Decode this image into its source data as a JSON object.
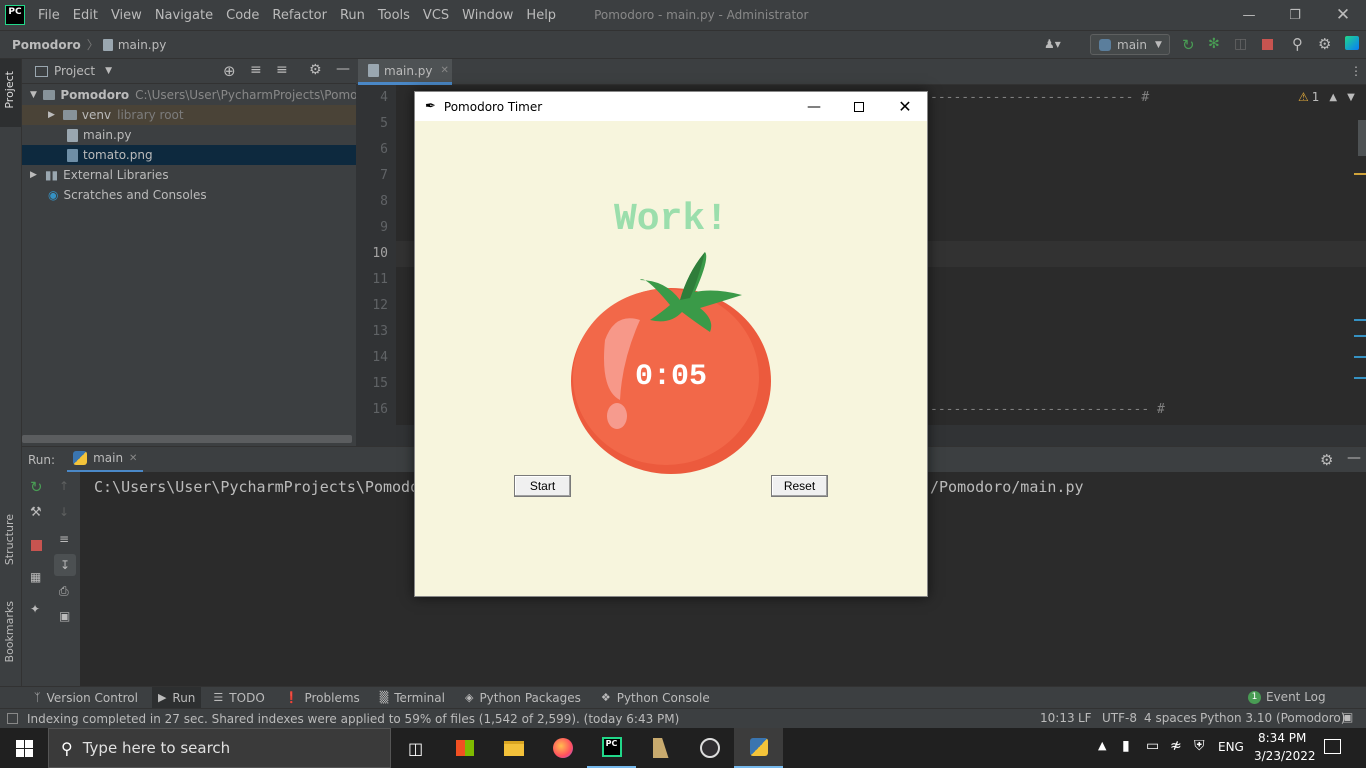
{
  "menubar": {
    "logo": "PC",
    "items": [
      "File",
      "Edit",
      "View",
      "Navigate",
      "Code",
      "Refactor",
      "Run",
      "Tools",
      "VCS",
      "Window",
      "Help"
    ],
    "window_title": "Pomodoro - main.py - Administrator"
  },
  "navbar": {
    "project": "Pomodoro",
    "file": "main.py",
    "run_config": "main"
  },
  "left_tools": {
    "project": "Project",
    "structure": "Structure",
    "bookmarks": "Bookmarks"
  },
  "project_panel": {
    "title": "Project",
    "root_name": "Pomodoro",
    "root_path": "C:\\Users\\User\\PycharmProjects\\Pomodoro",
    "venv": "venv",
    "venv_note": "library root",
    "file1": "main.py",
    "file2": "tomato.png",
    "external": "External Libraries",
    "scratches": "Scratches and Consoles"
  },
  "editor": {
    "tab": "main.py",
    "line_numbers": [
      "4",
      "5",
      "6",
      "7",
      "8",
      "9",
      "10",
      "11",
      "12",
      "13",
      "14",
      "15",
      "16"
    ],
    "code_line4": "-------------------------- #",
    "code_line16": "---------------------------- #",
    "warnings": "1"
  },
  "run_panel": {
    "label": "Run:",
    "tab": "main",
    "console_left": "C:\\Users\\User\\PycharmProjects\\Pomodo",
    "console_right": "/Pomodoro/main.py"
  },
  "bottom_tools": [
    "Version Control",
    "Run",
    "TODO",
    "Problems",
    "Terminal",
    "Python Packages",
    "Python Console"
  ],
  "event_log": {
    "count": "1",
    "label": "Event Log"
  },
  "statusbar": {
    "message": "Indexing completed in 27 sec. Shared indexes were applied to 59% of files (1,542 of 2,599). (today 6:43 PM)",
    "position": "10:13",
    "line_sep": "LF",
    "encoding": "UTF-8",
    "indent": "4 spaces",
    "interpreter": "Python 3.10 (Pomodoro)"
  },
  "taskbar": {
    "search_placeholder": "Type here to search",
    "lang": "ENG",
    "time": "8:34 PM",
    "date": "3/23/2022"
  },
  "dialog": {
    "title": "Pomodoro Timer",
    "heading": "Work!",
    "timer": "0:05",
    "start": "Start",
    "reset": "Reset",
    "colors": {
      "bg": "#f7f5dd",
      "heading": "#9bdeac",
      "tomato": "#f26849"
    }
  }
}
